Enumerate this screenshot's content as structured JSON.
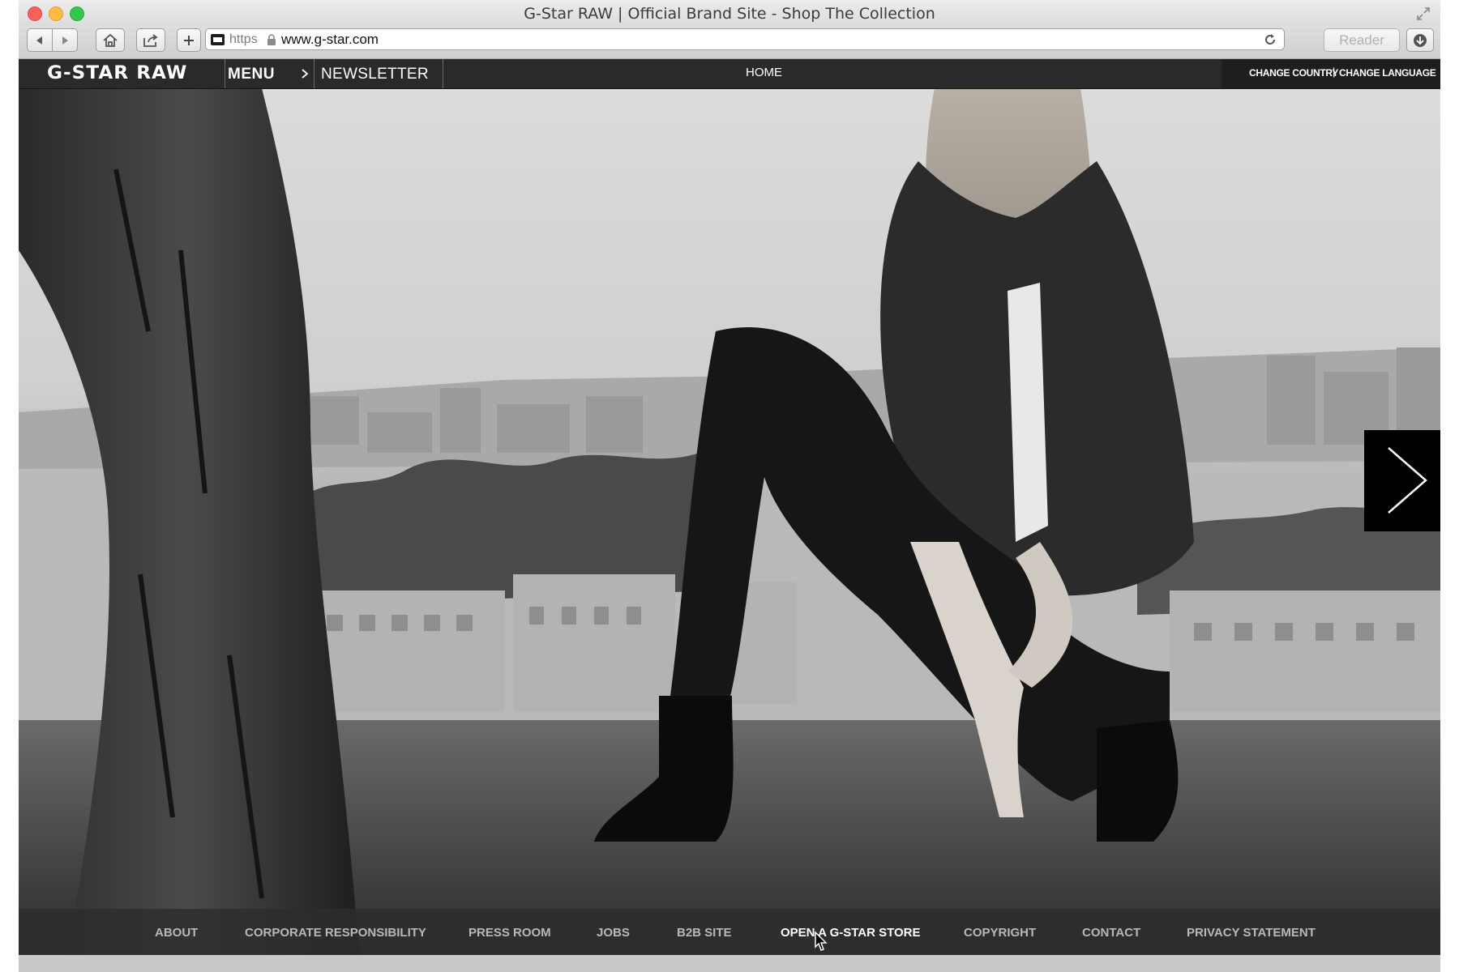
{
  "browser": {
    "window_title": "G-Star RAW | Official Brand Site - Shop The Collection",
    "scheme": "https",
    "url": "www.g-star.com",
    "reader_label": "Reader"
  },
  "header": {
    "logo": "G-STAR RAW",
    "menu_label": "MENU",
    "newsletter_label": "NEWSLETTER",
    "home_label": "HOME",
    "change_country_label": "CHANGE COUNTRY",
    "separator": "|",
    "change_language_label": "CHANGE LANGUAGE"
  },
  "footer": {
    "links": [
      {
        "label": "ABOUT"
      },
      {
        "label": "CORPORATE RESPONSIBILITY"
      },
      {
        "label": "PRESS ROOM"
      },
      {
        "label": "JOBS"
      },
      {
        "label": "B2B SITE"
      },
      {
        "label": "OPEN A G-STAR STORE"
      },
      {
        "label": "COPYRIGHT"
      },
      {
        "label": "CONTACT"
      },
      {
        "label": "PRIVACY STATEMENT"
      }
    ]
  },
  "icons": {
    "back": "chevron-left-icon",
    "forward": "chevron-right-icon",
    "home": "home-icon",
    "share": "share-icon",
    "add": "plus-icon",
    "lock": "lock-icon",
    "reload": "reload-icon",
    "download": "download-icon",
    "next": "chevron-right-icon",
    "cursor": "pointer-cursor-icon"
  }
}
